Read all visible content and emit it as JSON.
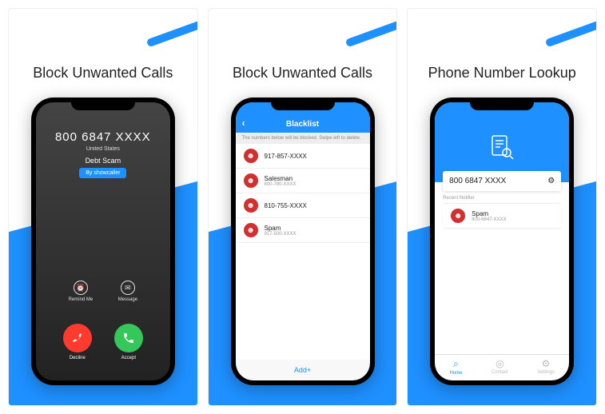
{
  "panels": [
    {
      "title": "Block Unwanted Calls",
      "call": {
        "number": "800 6847 XXXX",
        "location": "United States",
        "tag": "Debt Scam",
        "badge": "By showcaller",
        "remind_label": "Remind Me",
        "message_label": "Message",
        "decline_label": "Decline",
        "accept_label": "Accept"
      }
    },
    {
      "title": "Block Unwanted Calls",
      "blacklist": {
        "header": "Blacklist",
        "hint": "The numbers below will be blocked. Swipe left to delete.",
        "rows": [
          {
            "line1": "917-857-XXXX",
            "line2": ""
          },
          {
            "line1": "Salesman",
            "line2": "800-780-XXXX"
          },
          {
            "line1": "810-755-XXXX",
            "line2": ""
          },
          {
            "line1": "Spam",
            "line2": "917-500-XXXX"
          }
        ],
        "add_label": "Add+"
      }
    },
    {
      "title": "Phone Number Lookup",
      "lookup": {
        "query": "800 6847 XXXX",
        "section": "Recent Notifier",
        "result": {
          "line1": "Spam",
          "line2": "800-6847-XXXX"
        },
        "tabs": [
          {
            "label": "Home",
            "active": true
          },
          {
            "label": "Contact",
            "active": false
          },
          {
            "label": "Settings",
            "active": false
          }
        ]
      }
    }
  ]
}
